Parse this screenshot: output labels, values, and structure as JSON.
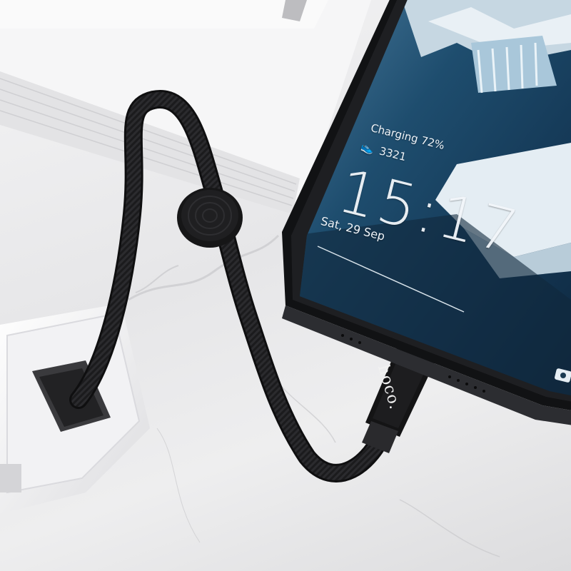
{
  "lockscreen": {
    "charging_label": "Charging 72%",
    "steps_icon": "shoe-icon",
    "steps_count": "3321",
    "time": "15:17",
    "date": "Sat, 29 Sep",
    "camera_icon": "camera-icon"
  },
  "cable": {
    "brand_text": "hoco."
  },
  "colors": {
    "marble": "#ececee",
    "cable": "#1b1b1d",
    "phone_frame": "#1e1f22",
    "screen_water": "#173d5a",
    "ice": "#e8f0f4"
  }
}
